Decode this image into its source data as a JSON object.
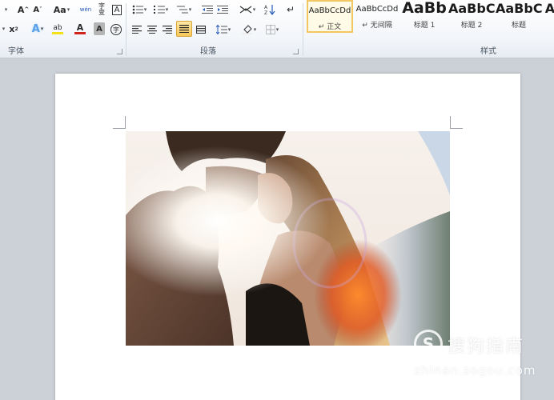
{
  "colors": {
    "highlight": "#f3e21a",
    "font_color": "#d0231c",
    "selected_border": "#f3c760"
  },
  "ribbon": {
    "font_group": {
      "label": "字体",
      "buttons": {
        "grow_font": "A",
        "shrink_font": "A",
        "change_case": "Aa",
        "phonetic_guide": "wén",
        "character_border": "A",
        "superscript": "x",
        "text_effects": "A",
        "highlight": "ab",
        "font_color": "A",
        "character_shading": "A",
        "enclose_characters": "字"
      }
    },
    "paragraph_group": {
      "label": "段落"
    },
    "styles_group": {
      "label": "样式",
      "items": [
        {
          "sample": "AaBbCcDd",
          "name": "↵ 正文",
          "selected": true
        },
        {
          "sample": "AaBbCcDd",
          "name": "↵ 无间隔",
          "selected": false
        },
        {
          "sample": "AaBb",
          "name": "标题 1",
          "selected": false
        },
        {
          "sample": "AaBbC",
          "name": "标题 2",
          "selected": false
        },
        {
          "sample": "AaBbC",
          "name": "标题",
          "selected": false
        },
        {
          "sample": "A",
          "name": "",
          "selected": false
        }
      ]
    }
  },
  "watermark": {
    "logo": "S",
    "name": "搜狗指南",
    "url": "zhinan.sogou.com"
  }
}
